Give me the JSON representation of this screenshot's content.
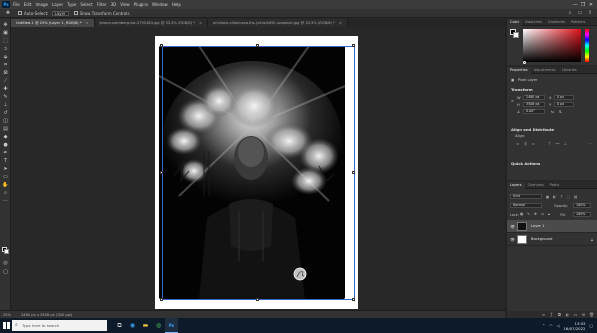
{
  "app": {
    "logo": "Ps"
  },
  "menubar": {
    "items": [
      "File",
      "Edit",
      "Image",
      "Layer",
      "Type",
      "Select",
      "Filter",
      "3D",
      "View",
      "Plugins",
      "Window",
      "Help"
    ],
    "window_controls": [
      "—",
      "❐",
      "✕"
    ]
  },
  "options_bar": {
    "auto_select_label": "Auto-Select:",
    "auto_select_target": "Layer",
    "show_transform_label": "Show Transform Controls"
  },
  "document_tabs": [
    {
      "title": "Untitled-1 @ 25% (Layer 1, RGB/8) *",
      "active": true
    },
    {
      "title": "jeroen-volmberg-bw-5795184.jpg @ 33.3% (RGB/8) *",
      "active": false
    },
    {
      "title": "emiliano-villanueva-lhs-ysCw0bEEI-unsplash.jpg @ 33.3% (RGB/8) *",
      "active": false
    }
  ],
  "status_bar": {
    "zoom": "25%",
    "doc_size": "2480 px x 3508 px (300 ppi)"
  },
  "panels": {
    "color": {
      "tabs": [
        "Color",
        "Swatches",
        "Gradients",
        "Patterns"
      ]
    },
    "properties": {
      "tabs": [
        "Properties",
        "Adjustments",
        "Libraries"
      ],
      "layer_kind": "Pixel Layer",
      "transform_title": "Transform",
      "w_label": "W",
      "w_value": "2480 px",
      "h_label": "H",
      "h_value": "3508 px",
      "x_label": "X",
      "x_value": "0 px",
      "y_label": "Y",
      "y_value": "0 px",
      "angle_value": "0.00°",
      "align_title": "Align and Distribute",
      "align_label": "Align:",
      "quick_actions_title": "Quick Actions"
    },
    "layers": {
      "tabs": [
        "Layers",
        "Channels",
        "Paths"
      ],
      "kind_filter": "Kind",
      "blend_mode": "Normal",
      "opacity_label": "Opacity:",
      "opacity_value": "100%",
      "lock_label": "Lock:",
      "fill_label": "Fill:",
      "fill_value": "100%",
      "layers": [
        {
          "name": "Layer 1",
          "selected": true
        },
        {
          "name": "Background",
          "selected": false
        }
      ]
    }
  },
  "taskbar": {
    "search_placeholder": "Type here to search",
    "clock_time": "13:03",
    "clock_date": "16/07/2022"
  },
  "colors": {
    "accent": "#31a8ff",
    "selection": "#3366cc",
    "foreground": "#000000",
    "background": "#ffffff"
  }
}
